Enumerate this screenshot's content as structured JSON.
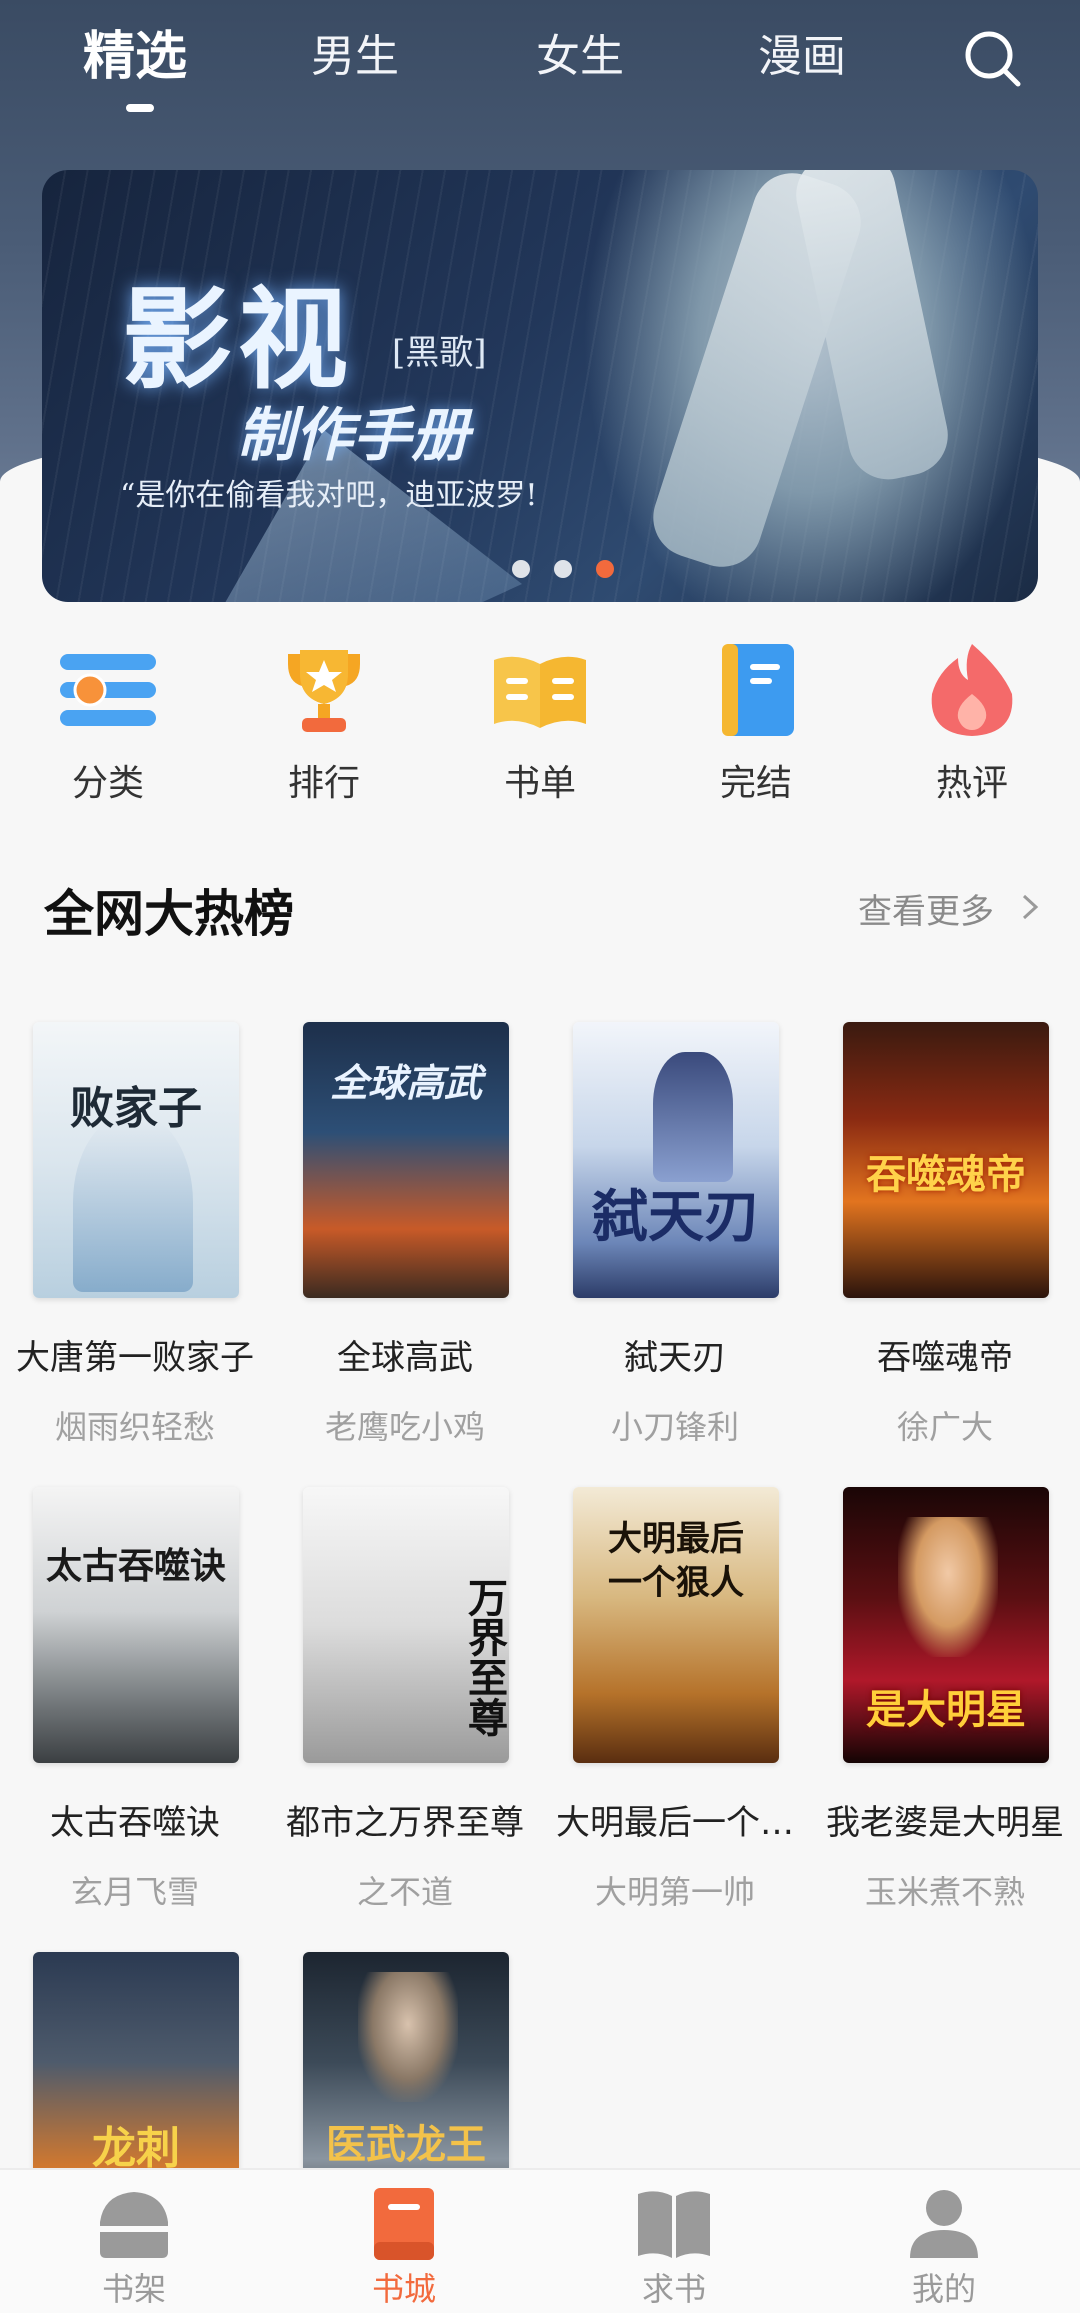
{
  "header": {
    "tabs": [
      {
        "label": "精选",
        "active": true
      },
      {
        "label": "男生",
        "active": false
      },
      {
        "label": "女生",
        "active": false
      },
      {
        "label": "漫画",
        "active": false
      }
    ],
    "search_icon": "search-icon"
  },
  "banner": {
    "title": "影视",
    "tag": "[黑歌]",
    "subtitle": "制作手册",
    "quote": "“是你在偷看我对吧，迪亚波罗!",
    "dots_count": 3,
    "active_dot": 3
  },
  "categories": [
    {
      "label": "分类",
      "icon": "category-icon"
    },
    {
      "label": "排行",
      "icon": "trophy-icon"
    },
    {
      "label": "书单",
      "icon": "open-book-icon"
    },
    {
      "label": "完结",
      "icon": "finished-book-icon"
    },
    {
      "label": "热评",
      "icon": "flame-icon"
    }
  ],
  "section": {
    "title": "全网大热榜",
    "more": "查看更多"
  },
  "books": [
    {
      "title": "大唐第一败家子",
      "author": "烟雨织轻愁",
      "cover_text": "败家子"
    },
    {
      "title": "全球高武",
      "author": "老鹰吃小鸡",
      "cover_text": "全球高武"
    },
    {
      "title": "弑天刃",
      "author": "小刀锋利",
      "cover_text": "弑天刃"
    },
    {
      "title": "吞噬魂帝",
      "author": "徐广大",
      "cover_text": "吞噬魂帝"
    },
    {
      "title": "太古吞噬诀",
      "author": "玄月飞雪",
      "cover_text": "太古吞噬诀"
    },
    {
      "title": "都市之万界至尊",
      "author": "之不道",
      "cover_text": "万界至尊"
    },
    {
      "title": "大明最后一个…",
      "author": "大明第一帅",
      "cover_text": "大明最后一个狠人"
    },
    {
      "title": "我老婆是大明星",
      "author": "玉米煮不熟",
      "cover_text": "是大明星"
    },
    {
      "title": "",
      "author": "",
      "cover_text": "龙刺"
    },
    {
      "title": "",
      "author": "",
      "cover_text": "医武龙王"
    }
  ],
  "bottom_nav": [
    {
      "label": "书架",
      "icon": "bookshelf-icon",
      "active": false
    },
    {
      "label": "书城",
      "icon": "bookstore-icon",
      "active": true
    },
    {
      "label": "求书",
      "icon": "request-book-icon",
      "active": false
    },
    {
      "label": "我的",
      "icon": "profile-icon",
      "active": false
    }
  ],
  "colors": {
    "accent": "#f26a3d",
    "header_bg": "#4a5c76",
    "inactive_nav": "#9a9a9a"
  }
}
